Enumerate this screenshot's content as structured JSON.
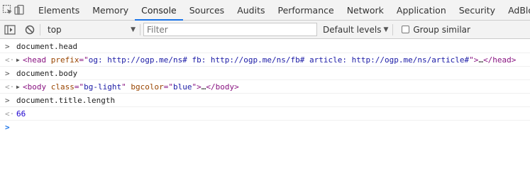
{
  "tabs": [
    {
      "label": "Elements",
      "active": false
    },
    {
      "label": "Memory",
      "active": false
    },
    {
      "label": "Console",
      "active": true
    },
    {
      "label": "Sources",
      "active": false
    },
    {
      "label": "Audits",
      "active": false
    },
    {
      "label": "Performance",
      "active": false
    },
    {
      "label": "Network",
      "active": false
    },
    {
      "label": "Application",
      "active": false
    },
    {
      "label": "Security",
      "active": false
    },
    {
      "label": "AdBlock",
      "active": false
    }
  ],
  "toolbar": {
    "context": "top",
    "filter_placeholder": "Filter",
    "levels_label": "Default levels",
    "group_similar_label": "Group similar",
    "group_similar_checked": false
  },
  "console": {
    "cmd1": "document.head",
    "head": {
      "open_tag": "<head",
      "attr_name": "prefix",
      "attr_eq": "=\"",
      "attr_value": "og: http://ogp.me/ns# fb: http://ogp.me/ns/fb# article: http://ogp.me/ns/article#",
      "attr_close": "\">",
      "ellipsis": "…",
      "close_tag": "</head>"
    },
    "cmd2": "document.body",
    "body": {
      "open_tag": "<body",
      "attr1_name": "class",
      "attr1_value": "bg-light",
      "attr2_name": "bgcolor",
      "attr2_value": "blue",
      "attr_close": ">",
      "ellipsis": "…",
      "close_tag": "</body>"
    },
    "cmd3": "document.title.length",
    "result3": "66"
  },
  "colors": {
    "accent": "#1a73e8",
    "tag": "#881280",
    "attr_name": "#994500",
    "attr_value": "#1a1aa6",
    "number": "#1c00cf"
  },
  "icons": {
    "inspect": "inspect-element-icon",
    "device": "device-toolbar-icon",
    "sidebar": "console-sidebar-icon",
    "clear": "clear-console-icon"
  }
}
